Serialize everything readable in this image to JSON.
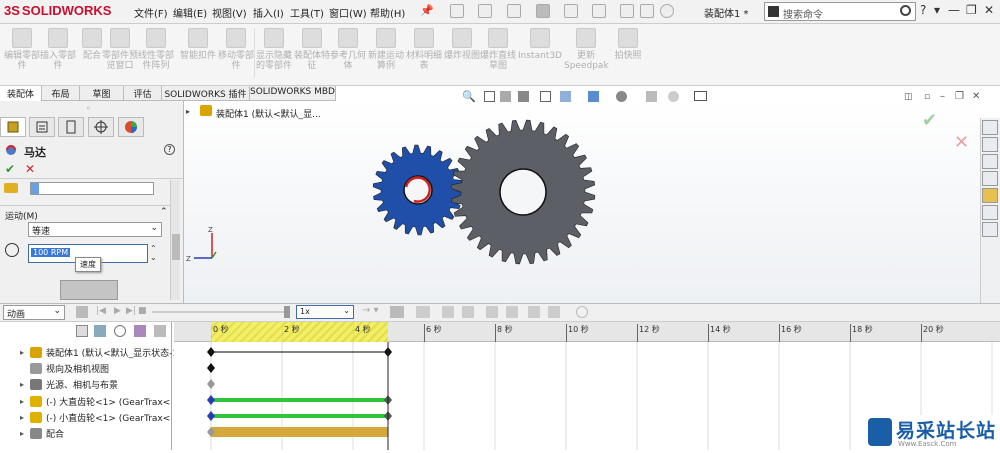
{
  "app": {
    "logo": "SOLIDWORKS",
    "logo_prefix": "3S"
  },
  "menu": [
    "文件(F)",
    "编辑(E)",
    "视图(V)",
    "插入(I)",
    "工具(T)",
    "窗口(W)",
    "帮助(H)"
  ],
  "document_title": "装配体1 *",
  "search": {
    "placeholder": "搜索命令"
  },
  "window_buttons": [
    "?",
    "▾",
    "—",
    "❐",
    "✕"
  ],
  "ribbon": [
    "编辑零部件",
    "插入零部件",
    "配合",
    "零部件预览窗口",
    "线性零部件阵列",
    "智能扣件",
    "移动零部件",
    "显示隐藏的零部件",
    "装配体特征",
    "参考几何体",
    "新建运动算例",
    "材料明细表",
    "爆炸视图",
    "爆炸直线草图",
    "Instant3D",
    "更新Speedpak",
    "拍快照"
  ],
  "tabs": [
    "装配体",
    "布局",
    "草图",
    "评估",
    "SOLIDWORKS 插件",
    "SOLIDWORKS MBD"
  ],
  "tree_top": "装配体1 (默认<默认_显...",
  "pm": {
    "title": "马达",
    "section": "运动(M)",
    "motion_type": "等速",
    "speed_value": "100 RPM",
    "tooltip": "速度"
  },
  "timeline": {
    "anim_mode": "动画",
    "speed": "1x",
    "ticks": [
      "0 秒",
      "2 秒",
      "4 秒",
      "6 秒",
      "8 秒",
      "10 秒",
      "12 秒",
      "14 秒",
      "16 秒",
      "18 秒",
      "20 秒"
    ]
  },
  "tree": [
    {
      "label": "装配体1 (默认<默认_显示状态-1>)",
      "color": "#d9a300"
    },
    {
      "label": "视向及相机视图",
      "color": "#999"
    },
    {
      "label": "光源、相机与布景",
      "color": "#777"
    },
    {
      "label": "(-) 大直齿轮<1> (GearTrax<",
      "color": "#e0b000"
    },
    {
      "label": "(-) 小直齿轮<1> (GearTrax<",
      "color": "#e0b000"
    },
    {
      "label": "配合",
      "color": "#888"
    }
  ],
  "brand": {
    "name": "易采站长站",
    "sub": "Www.Easck.Com"
  },
  "colors": {
    "small_gear": "#1f4fa8",
    "large_gear": "#5c5f66",
    "track_green": "#2fc43b",
    "track_gold": "#d4a83c",
    "range_yellow": "#f3ef5a",
    "brand_blue": "#1a5ea8"
  }
}
